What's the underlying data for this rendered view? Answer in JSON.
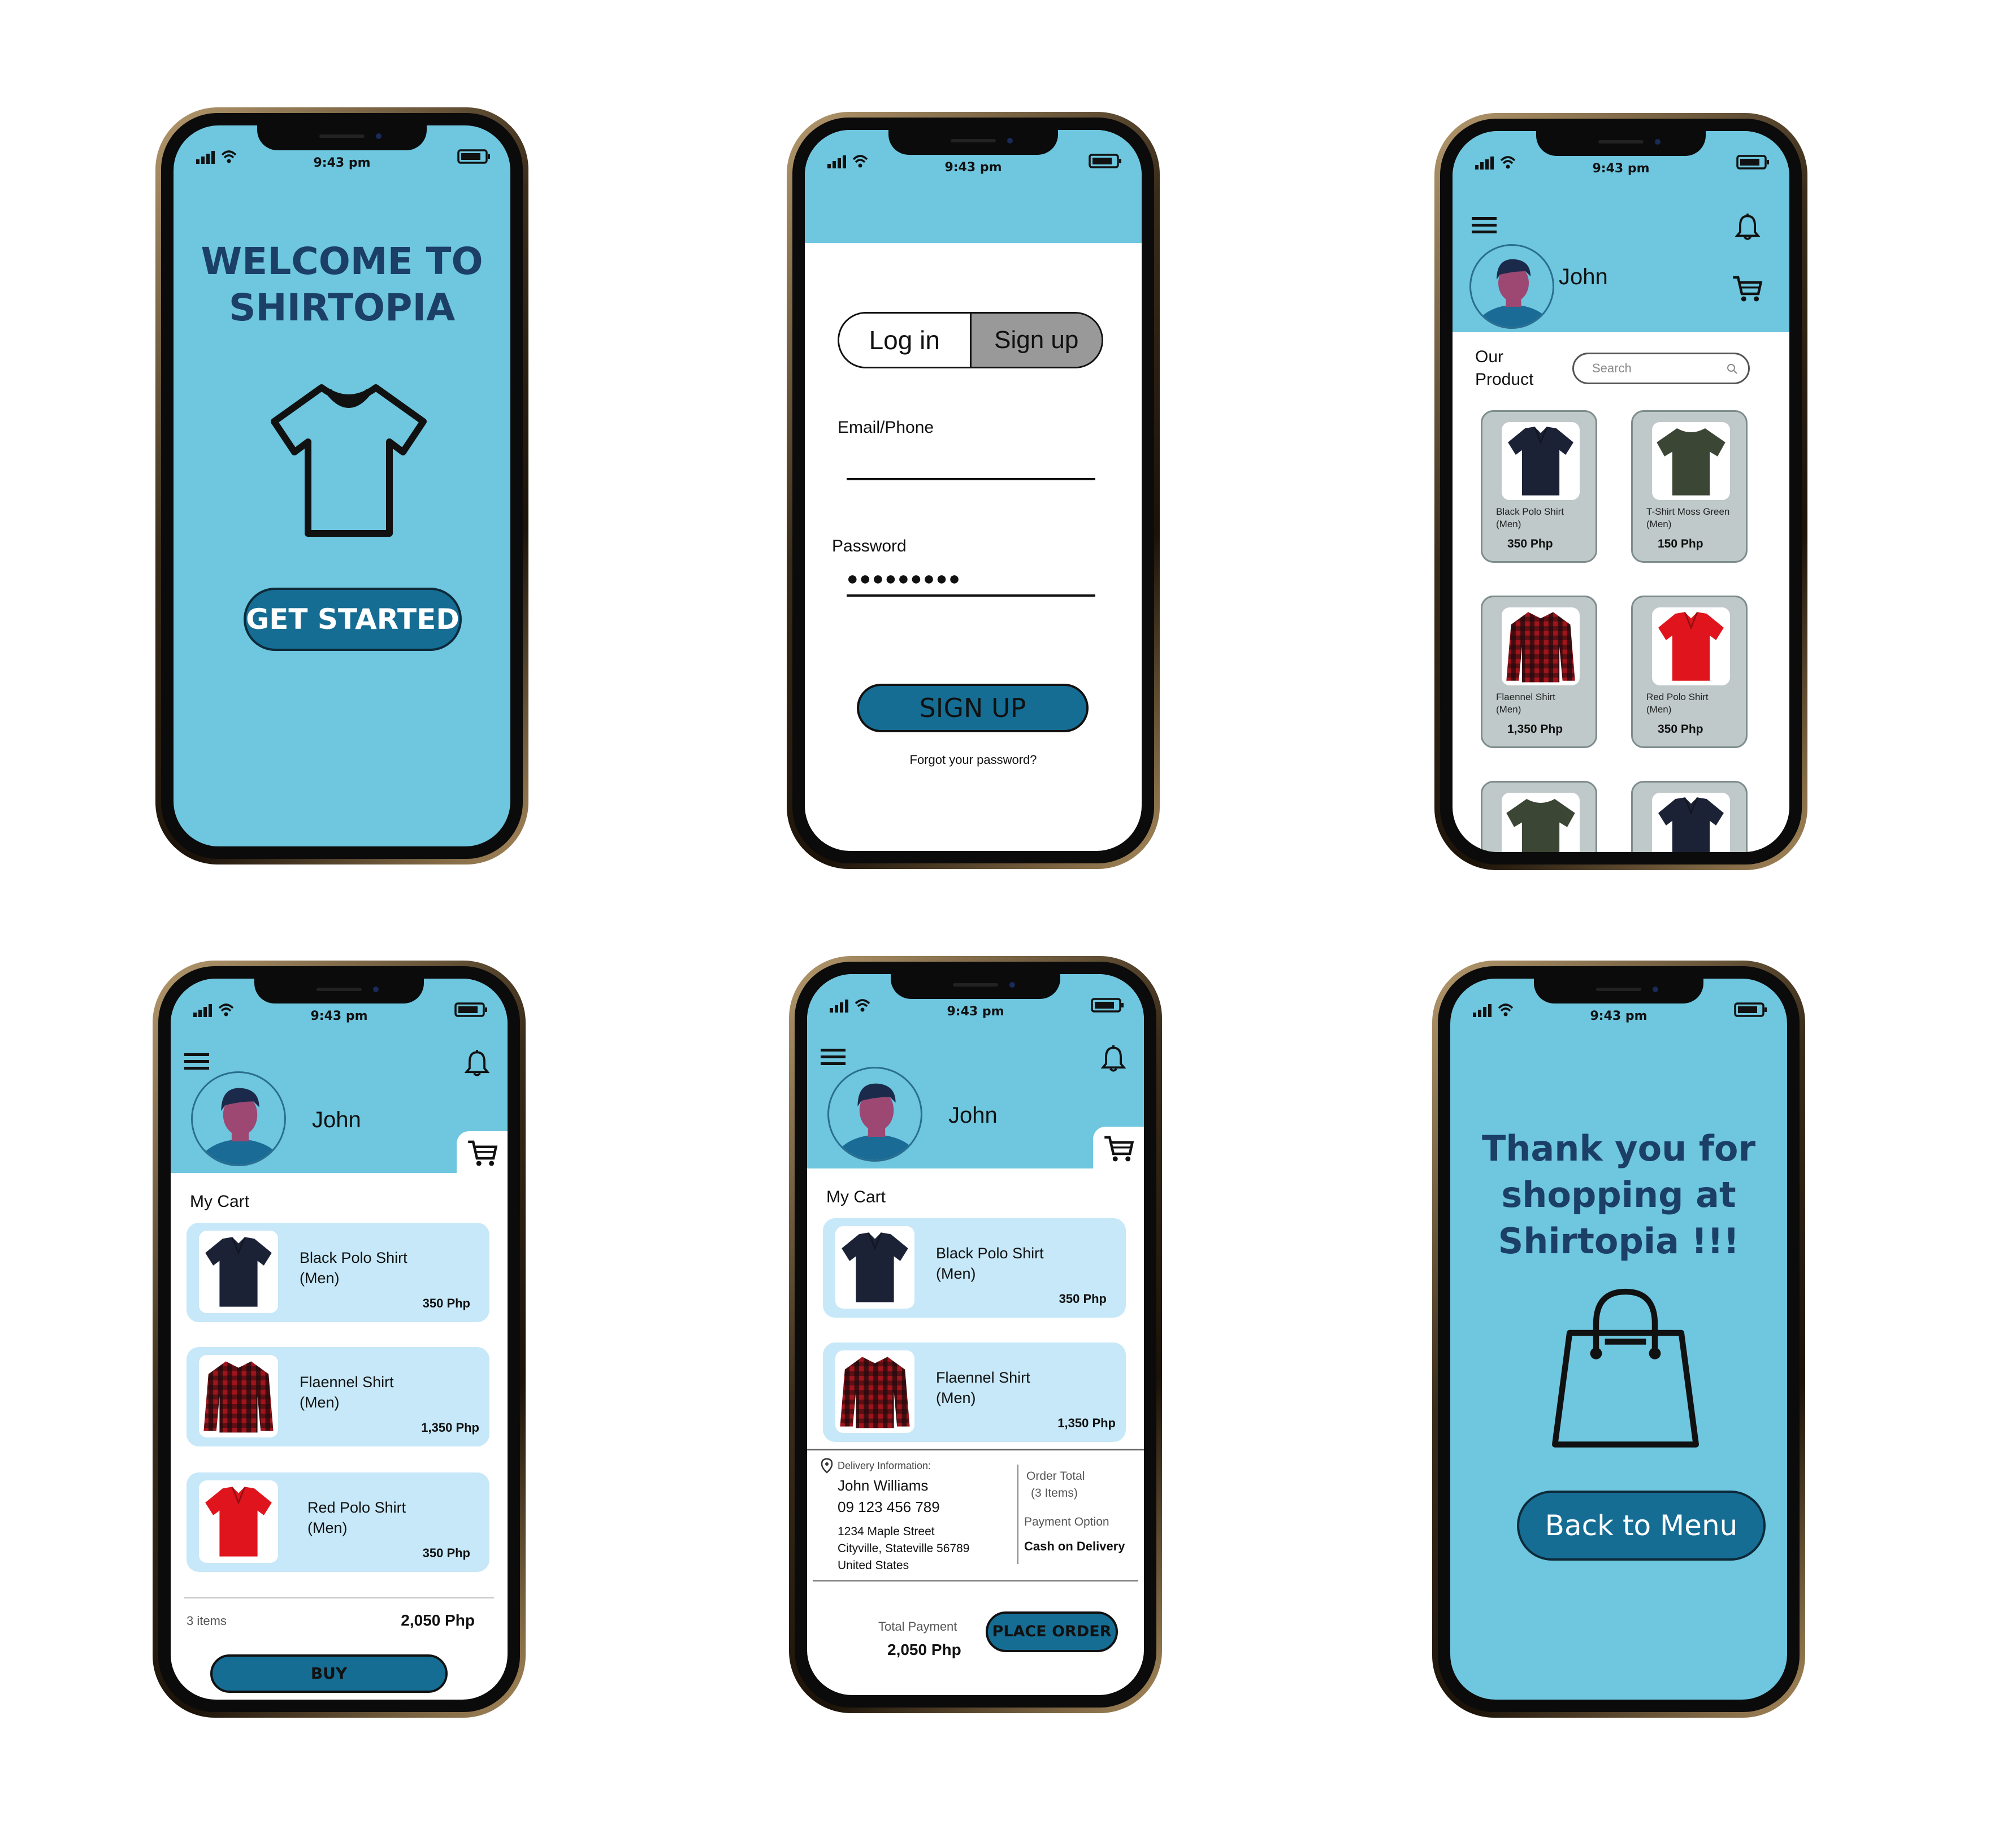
{
  "status": {
    "time": "9:43 pm"
  },
  "welcome": {
    "title_line1": "WELCOME TO",
    "title_line2": "SHIRTOPIA",
    "button": "GET STARTED"
  },
  "auth": {
    "tab_login": "Log in",
    "tab_signup": "Sign up",
    "email_label": "Email/Phone",
    "password_label": "Password",
    "password_value": "●●●●●●●●●",
    "submit": "SIGN UP",
    "forgot": "Forgot your password?"
  },
  "user": {
    "name": "John"
  },
  "catalog": {
    "heading_line1": "Our",
    "heading_line2": "Product",
    "search_placeholder": "Search",
    "products": [
      {
        "name1": "Black Polo Shirt",
        "name2": "(Men)",
        "price": "350 Php",
        "color": "#1c2236"
      },
      {
        "name1": "T-Shirt Moss Green",
        "name2": "(Men)",
        "price": "150 Php",
        "color": "#3b4634"
      },
      {
        "name1": "Flaennel Shirt",
        "name2": "(Men)",
        "price": "1,350 Php",
        "color": "#8a1820"
      },
      {
        "name1": "Red Polo Shirt",
        "name2": "(Men)",
        "price": "350 Php",
        "color": "#e0141c"
      }
    ]
  },
  "cart": {
    "heading": "My Cart",
    "items": [
      {
        "name1": "Black Polo Shirt",
        "name2": "(Men)",
        "price": "350 Php"
      },
      {
        "name1": "Flaennel Shirt",
        "name2": "(Men)",
        "price": "1,350 Php"
      },
      {
        "name1": "Red Polo Shirt",
        "name2": "(Men)",
        "price": "350 Php"
      }
    ],
    "count": "3 items",
    "total": "2,050 Php",
    "buy": "BUY"
  },
  "checkout": {
    "delivery_label": "Delivery Information:",
    "name": "John Williams",
    "phone": "09 123 456 789",
    "addr1": "1234 Maple Street",
    "addr2": "Cityville, Stateville 56789",
    "addr3": "United States",
    "order_total": "Order Total",
    "order_items": "(3 Items)",
    "payment_option": "Payment Option",
    "payment_value": "Cash on Delivery",
    "total_label": "Total Payment",
    "total_value": "2,050 Php",
    "place_order": "PLACE ORDER"
  },
  "thanks": {
    "line1": "Thank you for",
    "line2": "shopping at",
    "line3": "Shirtopia !!!",
    "button": "Back to Menu"
  },
  "colors": {
    "sky": "#6ec6df",
    "navy": "#1b3f66",
    "button": "#166d94",
    "card": "#c6e8f8"
  }
}
